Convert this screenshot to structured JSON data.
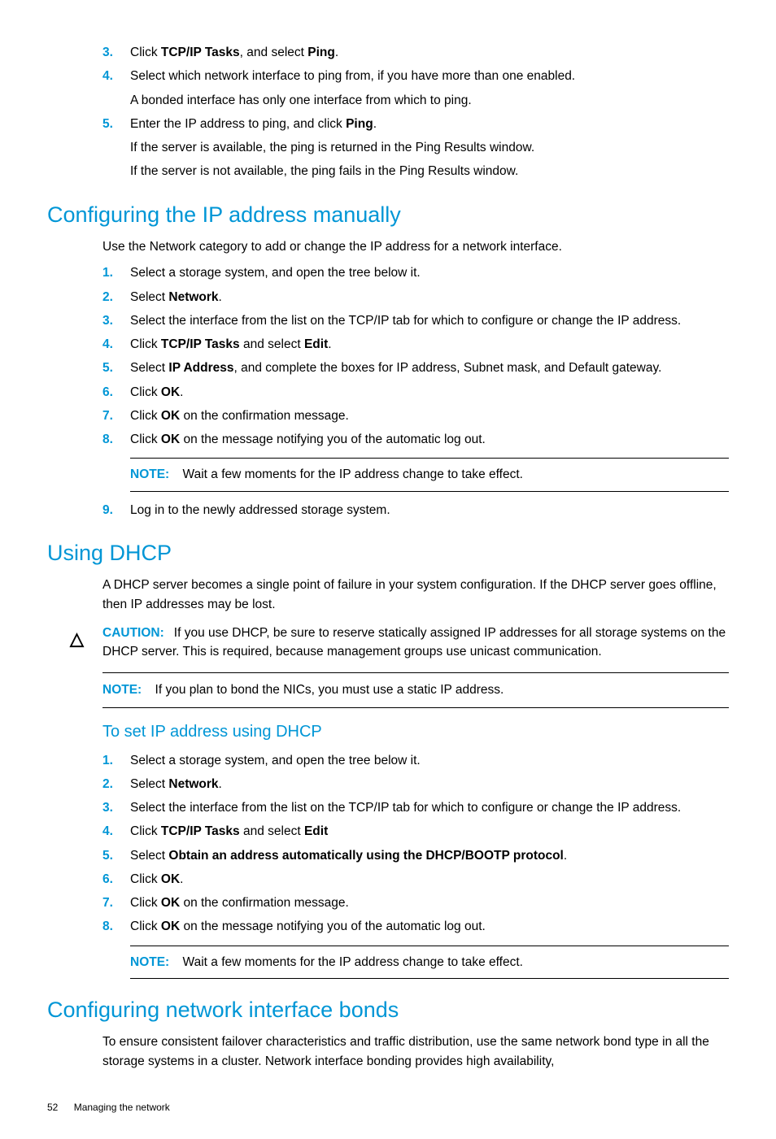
{
  "top_steps": [
    {
      "n": "3.",
      "html": "Click <b>TCP/IP Tasks</b>, and select <b>Ping</b>."
    },
    {
      "n": "4.",
      "html": "Select which network interface to ping from, if you have more than one enabled.<span class='sub'>A bonded interface has only one interface from which to ping.</span>"
    },
    {
      "n": "5.",
      "html": "Enter the IP address to ping, and click <b>Ping</b>.<span class='sub'>If the server is available, the ping is returned in the Ping Results window.</span><span class='sub'>If the server is not available, the ping fails in the Ping Results window.</span>"
    }
  ],
  "sec1": {
    "title": "Configuring the IP address manually",
    "intro": "Use the Network category to add or change the IP address for a network interface.",
    "steps_a": [
      {
        "n": "1.",
        "html": "Select a storage system, and open the tree below it."
      },
      {
        "n": "2.",
        "html": "Select <b>Network</b>."
      },
      {
        "n": "3.",
        "html": "Select the interface from the list on the TCP/IP tab for which to configure or change the IP address."
      },
      {
        "n": "4.",
        "html": "Click <b>TCP/IP Tasks</b> and select <b>Edit</b>."
      },
      {
        "n": "5.",
        "html": "Select <b>IP Address</b>, and complete the boxes for IP address, Subnet mask, and Default gateway."
      },
      {
        "n": "6.",
        "html": "Click <b>OK</b>."
      },
      {
        "n": "7.",
        "html": "Click <b>OK</b> on the confirmation message."
      },
      {
        "n": "8.",
        "html": "Click <b>OK</b> on the message notifying you of the automatic log out."
      }
    ],
    "note": {
      "label": "NOTE:",
      "text": "Wait a few moments for the IP address change to take effect."
    },
    "steps_b": [
      {
        "n": "9.",
        "html": "Log in to the newly addressed storage system."
      }
    ]
  },
  "sec2": {
    "title": "Using DHCP",
    "intro": "A DHCP server becomes a single point of failure in your system configuration. If the DHCP server goes offline, then IP addresses may be lost.",
    "caution": {
      "label": "CAUTION:",
      "text": "If you use DHCP, be sure to reserve statically assigned IP addresses for all storage systems on the DHCP server. This is required, because management groups use unicast communication."
    },
    "note_outer": {
      "label": "NOTE:",
      "text": "If you plan to bond the NICs, you must use a static IP address."
    },
    "subtitle": "To set IP address using DHCP",
    "steps": [
      {
        "n": "1.",
        "html": "Select a storage system, and open the tree below it."
      },
      {
        "n": "2.",
        "html": "Select <b>Network</b>."
      },
      {
        "n": "3.",
        "html": "Select the interface from the list on the TCP/IP tab for which to configure or change the IP address."
      },
      {
        "n": "4.",
        "html": "Click <b>TCP/IP Tasks</b> and select <b>Edit</b>"
      },
      {
        "n": "5.",
        "html": "Select <b>Obtain an address automatically using the DHCP/BOOTP protocol</b>."
      },
      {
        "n": "6.",
        "html": "Click <b>OK</b>."
      },
      {
        "n": "7.",
        "html": "Click <b>OK</b> on the confirmation message."
      },
      {
        "n": "8.",
        "html": "Click <b>OK</b> on the message notifying you of the automatic log out."
      }
    ],
    "note": {
      "label": "NOTE:",
      "text": "Wait a few moments for the IP address change to take effect."
    }
  },
  "sec3": {
    "title": "Configuring network interface bonds",
    "intro": "To ensure consistent failover characteristics and traffic distribution, use the same network bond type in all the storage systems in a cluster. Network interface bonding provides high availability,"
  },
  "footer": {
    "page": "52",
    "title": "Managing the network"
  }
}
